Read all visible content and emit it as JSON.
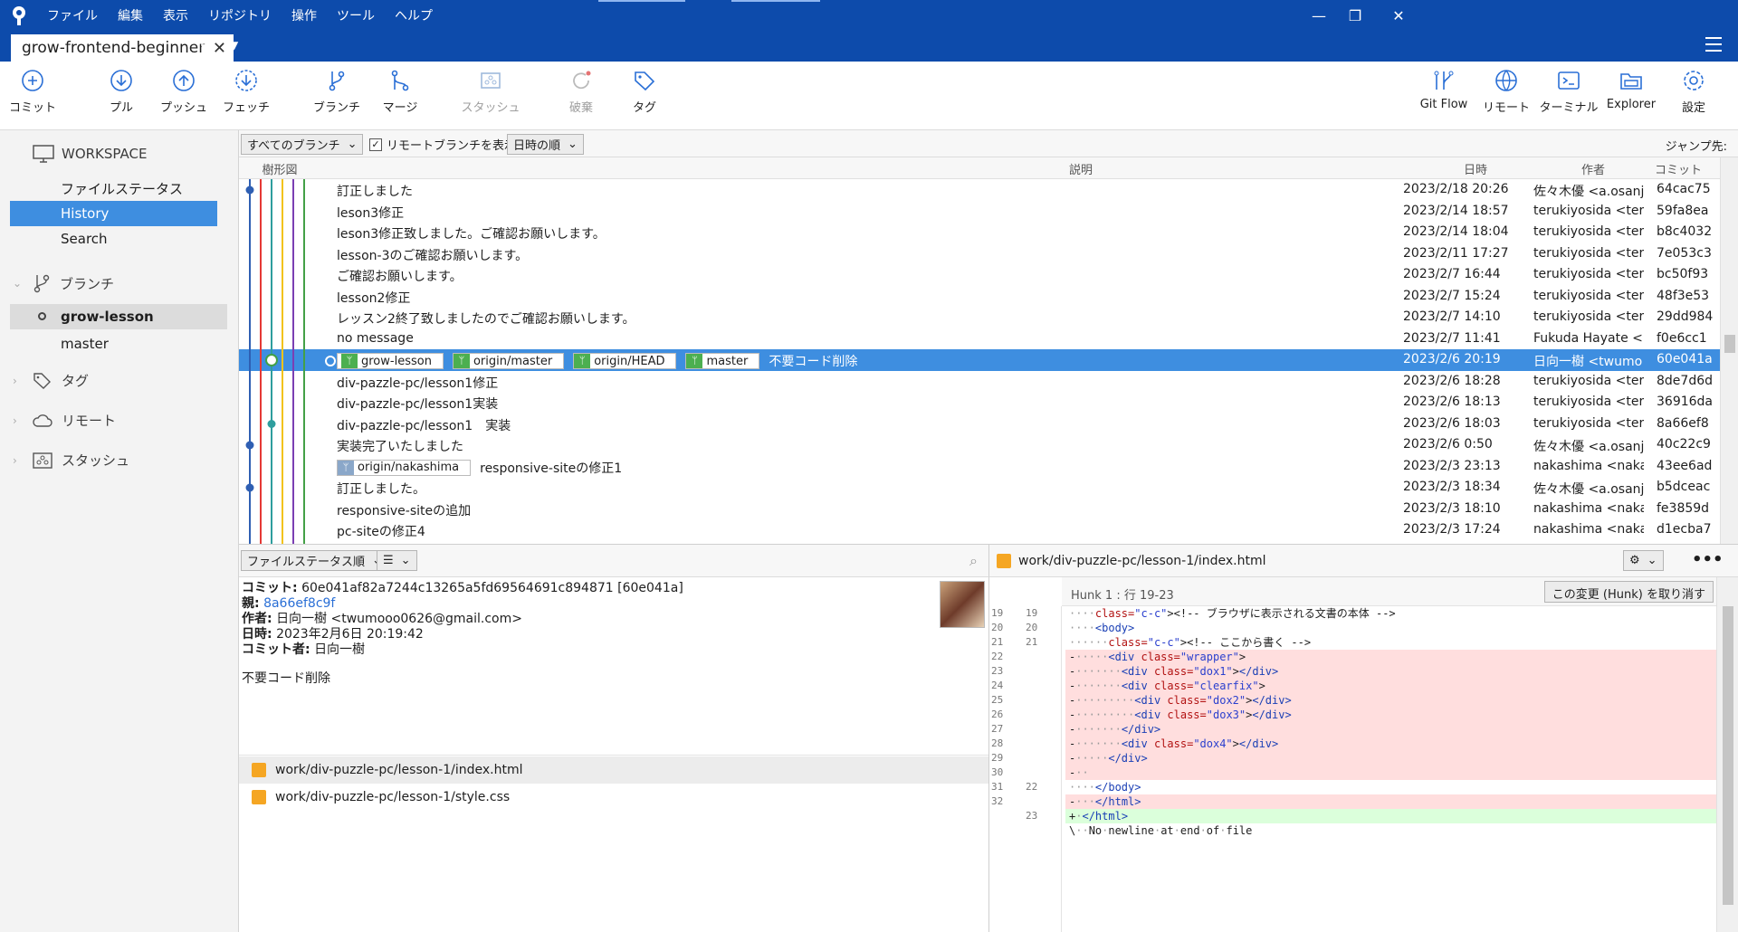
{
  "menu": [
    "ファイル",
    "編集",
    "表示",
    "リポジトリ",
    "操作",
    "ツール",
    "ヘルプ"
  ],
  "tab": {
    "title": "grow-frontend-beginner"
  },
  "toolbar": {
    "commit": "コミット",
    "pull": "プル",
    "push": "プッシュ",
    "fetch": "フェッチ",
    "branch": "ブランチ",
    "merge": "マージ",
    "stash": "スタッシュ",
    "discard": "破棄",
    "tag": "タグ",
    "gitflow": "Git Flow",
    "remote": "リモート",
    "terminal": "ターミナル",
    "explorer": "Explorer",
    "settings": "設定"
  },
  "sidebar": {
    "workspace": "WORKSPACE",
    "items": [
      "ファイルステータス",
      "History",
      "Search"
    ],
    "branches_header": "ブランチ",
    "branches": [
      "grow-lesson",
      "master"
    ],
    "tags": "タグ",
    "remotes": "リモート",
    "stashes": "スタッシュ"
  },
  "filter": {
    "branches": "すべてのブランチ",
    "show_remote": "リモートブランチを表示",
    "order": "日時の順",
    "jump": "ジャンプ先:"
  },
  "columns": {
    "graph": "樹形図",
    "description": "説明",
    "date": "日時",
    "author": "作者",
    "commit": "コミット"
  },
  "commits": [
    {
      "desc": "訂正しました",
      "date": "2023/2/18 20:26",
      "author": "佐々木優 <a.osanj.",
      "hash": "64cac75"
    },
    {
      "desc": "leson3修正",
      "date": "2023/2/14 18:57",
      "author": "terukiyosida <terul",
      "hash": "59fa8ea"
    },
    {
      "desc": "leson3修正致しました。ご確認お願いします。",
      "date": "2023/2/14 18:04",
      "author": "terukiyosida <terul",
      "hash": "b8c4032"
    },
    {
      "desc": "lesson-3のご確認お願いします。",
      "date": "2023/2/11 17:27",
      "author": "terukiyosida <terul",
      "hash": "7e053c3"
    },
    {
      "desc": "ご確認お願いします。",
      "date": "2023/2/7 16:44",
      "author": "terukiyosida <terul",
      "hash": "bc50f93"
    },
    {
      "desc": "lesson2修正",
      "date": "2023/2/7 15:24",
      "author": "terukiyosida <terul",
      "hash": "48f3e53"
    },
    {
      "desc": "レッスン2終了致しましたのでご確認お願いします。",
      "date": "2023/2/7 14:10",
      "author": "terukiyosida <terul",
      "hash": "29dd984"
    },
    {
      "desc": "no message",
      "date": "2023/2/7 11:41",
      "author": "Fukuda Hayate <m",
      "hash": "f0e6cc1"
    },
    {
      "desc": "不要コード削除",
      "date": "2023/2/6 20:19",
      "author": "日向一樹 <twumo",
      "hash": "60e041a",
      "refs": [
        "grow-lesson",
        "origin/master",
        "origin/HEAD",
        "master"
      ]
    },
    {
      "desc": "div-pazzle-pc/lesson1修正",
      "date": "2023/2/6 18:28",
      "author": "terukiyosida <terul",
      "hash": "8de7d6d"
    },
    {
      "desc": "div-pazzle-pc/lesson1実装",
      "date": "2023/2/6 18:13",
      "author": "terukiyosida <terul",
      "hash": "36916da"
    },
    {
      "desc": "div-pazzle-pc/lesson1　実装",
      "date": "2023/2/6 18:03",
      "author": "terukiyosida <terul",
      "hash": "8a66ef8"
    },
    {
      "desc": "実装完了いたしました",
      "date": "2023/2/6 0:50",
      "author": "佐々木優 <a.osanj.",
      "hash": "40c22c9"
    },
    {
      "desc": "responsive-siteの修正1",
      "date": "2023/2/3 23:13",
      "author": "nakashima <nakas",
      "hash": "43ee6ad",
      "refs": [
        "origin/nakashima"
      ]
    },
    {
      "desc": "訂正しました。",
      "date": "2023/2/3 18:34",
      "author": "佐々木優 <a.osanj.",
      "hash": "b5dceac"
    },
    {
      "desc": "responsive-siteの追加",
      "date": "2023/2/3 18:10",
      "author": "nakashima <nakas",
      "hash": "fe3859d"
    },
    {
      "desc": "pc-siteの修正4",
      "date": "2023/2/3 17:24",
      "author": "nakashima <nakas",
      "hash": "d1ecba7"
    }
  ],
  "details": {
    "sort": "ファイルステータス順",
    "commit_label": "コミット:",
    "commit_value": "60e041af82a7244c13265a5fd69564691c894871 [60e041a]",
    "parent_label": "親:",
    "parent_value": "8a66ef8c9f",
    "author_label": "作者:",
    "author_value": "日向一樹 <twumooo0626@gmail.com>",
    "date_label": "日時:",
    "date_value": "2023年2月6日 20:19:42",
    "committer_label": "コミット者:",
    "committer_value": "日向一樹",
    "message": "不要コード削除"
  },
  "files": [
    "work/div-puzzle-pc/lesson-1/index.html",
    "work/div-puzzle-pc/lesson-1/style.css"
  ],
  "diff": {
    "file": "work/div-puzzle-pc/lesson-1/index.html",
    "hunk": "Hunk 1 : 行 19-23",
    "discard_hunk": "この変更 (Hunk) を取り消す",
    "lines": [
      {
        "type": "ctx",
        "o": "19",
        "n": "19",
        "text": "····<!-- ブラウザに表示される文書の本体 -->"
      },
      {
        "type": "ctx",
        "o": "20",
        "n": "20",
        "text": "····<body>"
      },
      {
        "type": "ctx",
        "o": "21",
        "n": "21",
        "text": "······<!-- ここから書く -->"
      },
      {
        "type": "del",
        "o": "22",
        "n": "",
        "text": "-·····<div class=\"wrapper\">"
      },
      {
        "type": "del",
        "o": "23",
        "n": "",
        "text": "-·······<div class=\"dox1\"></div>"
      },
      {
        "type": "del",
        "o": "24",
        "n": "",
        "text": "-·······<div class=\"clearfix\">"
      },
      {
        "type": "del",
        "o": "25",
        "n": "",
        "text": "-·········<div class=\"dox2\"></div>"
      },
      {
        "type": "del",
        "o": "26",
        "n": "",
        "text": "-·········<div class=\"dox3\"></div>"
      },
      {
        "type": "del",
        "o": "27",
        "n": "",
        "text": "-·······</div>"
      },
      {
        "type": "del",
        "o": "28",
        "n": "",
        "text": "-·······<div class=\"dox4\"></div>"
      },
      {
        "type": "del",
        "o": "29",
        "n": "",
        "text": "-·····</div>"
      },
      {
        "type": "del",
        "o": "30",
        "n": "",
        "text": "-··"
      },
      {
        "type": "ctx",
        "o": "31",
        "n": "22",
        "text": "····</body>"
      },
      {
        "type": "del",
        "o": "32",
        "n": "",
        "text": "-···</html>"
      },
      {
        "type": "add",
        "o": "",
        "n": "23",
        "text": "+·</html>"
      },
      {
        "type": "ctx",
        "o": "",
        "n": "",
        "text": "\\··No·newline·at·end·of·file"
      }
    ]
  },
  "colors": {
    "titlebar": "#0d4bab",
    "selection": "#3e8ee0",
    "graph_lanes": [
      "#2f5fb3",
      "#e53935",
      "#2e9e9e",
      "#f2c318",
      "#7b3fb3",
      "#43a047"
    ]
  }
}
